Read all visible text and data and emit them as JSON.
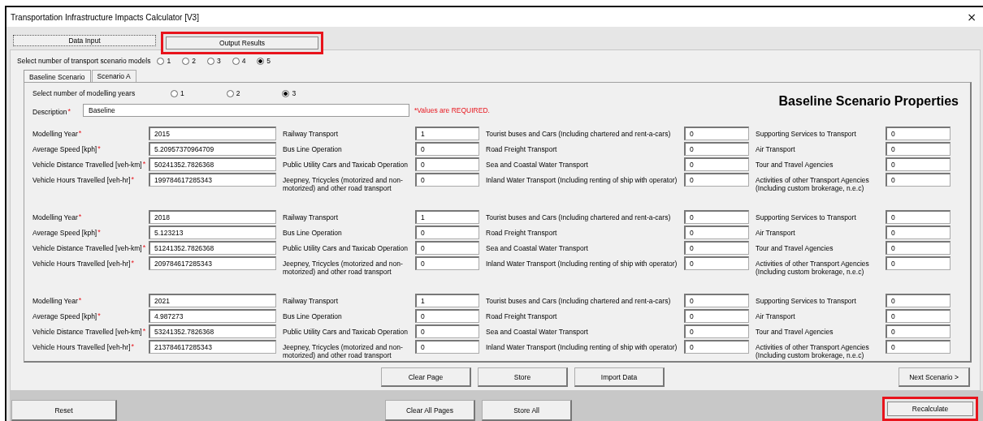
{
  "window": {
    "title": "Transportation Infrastructure Impacts Calculator [V3]",
    "close": "×"
  },
  "main_tabs": [
    {
      "label": "Data Input",
      "selected": true,
      "highlighted": false
    },
    {
      "label": "Output Results",
      "selected": false,
      "highlighted": true
    }
  ],
  "scenario_models": {
    "label": "Select number of transport scenario models",
    "options": [
      {
        "label": "1",
        "selected": false
      },
      {
        "label": "2",
        "selected": false
      },
      {
        "label": "3",
        "selected": false
      },
      {
        "label": "4",
        "selected": false
      },
      {
        "label": "5",
        "selected": true
      }
    ]
  },
  "scenario_tabs": [
    {
      "label": "Baseline Scenario",
      "selected": true
    },
    {
      "label": "Scenario A",
      "selected": false
    }
  ],
  "modeling_years": {
    "label": "Select number of modelling years",
    "options": [
      {
        "label": "1",
        "selected": false
      },
      {
        "label": "2",
        "selected": false
      },
      {
        "label": "3",
        "selected": true
      }
    ]
  },
  "description": {
    "label": "Description",
    "required_mark": "*",
    "value": "Baseline"
  },
  "required_note": "*Values are REQUIRED.",
  "heading": "Baseline Scenario Properties",
  "years": [
    {
      "fields": [
        {
          "label": "Modelling Year",
          "required_mark": "*",
          "value": "2015"
        },
        {
          "label": "Average Speed [kph]",
          "required_mark": "*",
          "value": "5.20957370964709"
        },
        {
          "label": "Vehicle Distance Travelled [veh-km]",
          "required_mark": "*",
          "value": "50241352.7826368"
        },
        {
          "label": "Vehicle Hours Travelled [veh-hr]",
          "required_mark": "*",
          "value": "199784617285343"
        }
      ],
      "sectors": [
        {
          "label": "Railway Transport",
          "value": "1"
        },
        {
          "label": "Bus Line Operation",
          "value": "0"
        },
        {
          "label": "Public Utility Cars and Taxicab Operation",
          "value": "0"
        },
        {
          "label": "Jeepney, Tricycles (motorized and non-motorized) and other road transport",
          "value": "0"
        },
        {
          "label": "Tourist buses and Cars (Including chartered and rent-a-cars)",
          "value": "0"
        },
        {
          "label": "Road Freight Transport",
          "value": "0"
        },
        {
          "label": "Sea and Coastal Water Transport",
          "value": "0"
        },
        {
          "label": "Inland Water Transport (Including renting of ship with operator)",
          "value": "0"
        },
        {
          "label": "Supporting Services to Transport",
          "value": "0"
        },
        {
          "label": "Air Transport",
          "value": "0"
        },
        {
          "label": "Tour and Travel Agencies",
          "value": "0"
        },
        {
          "label": "Activities of other Transport Agencies (Including custom brokerage, n.e.c)",
          "value": "0"
        }
      ]
    },
    {
      "fields": [
        {
          "label": "Modelling Year",
          "required_mark": "*",
          "value": "2018"
        },
        {
          "label": "Average Speed [kph]",
          "required_mark": "*",
          "value": "5.123213"
        },
        {
          "label": "Vehicle Distance Travelled [veh-km]",
          "required_mark": "*",
          "value": "51241352.7826368"
        },
        {
          "label": "Vehicle Hours Travelled [veh-hr]",
          "required_mark": "*",
          "value": "209784617285343"
        }
      ],
      "sectors": [
        {
          "label": "Railway Transport",
          "value": "1"
        },
        {
          "label": "Bus Line Operation",
          "value": "0"
        },
        {
          "label": "Public Utility Cars and Taxicab Operation",
          "value": "0"
        },
        {
          "label": "Jeepney, Tricycles (motorized and non-motorized) and other road transport",
          "value": "0"
        },
        {
          "label": "Tourist buses and Cars (Including chartered and rent-a-cars)",
          "value": "0"
        },
        {
          "label": "Road Freight Transport",
          "value": "0"
        },
        {
          "label": "Sea and Coastal Water Transport",
          "value": "0"
        },
        {
          "label": "Inland Water Transport (Including renting of ship with operator)",
          "value": "0"
        },
        {
          "label": "Supporting Services to Transport",
          "value": "0"
        },
        {
          "label": "Air Transport",
          "value": "0"
        },
        {
          "label": "Tour and Travel Agencies",
          "value": "0"
        },
        {
          "label": "Activities of other Transport Agencies (Including custom brokerage, n.e.c)",
          "value": "0"
        }
      ]
    },
    {
      "fields": [
        {
          "label": "Modelling Year",
          "required_mark": "*",
          "value": "2021"
        },
        {
          "label": "Average Speed [kph]",
          "required_mark": "*",
          "value": "4.987273"
        },
        {
          "label": "Vehicle Distance Travelled [veh-km]",
          "required_mark": "*",
          "value": "53241352.7826368"
        },
        {
          "label": "Vehicle Hours Travelled [veh-hr]",
          "required_mark": "*",
          "value": "213784617285343"
        }
      ],
      "sectors": [
        {
          "label": "Railway Transport",
          "value": "1"
        },
        {
          "label": "Bus Line Operation",
          "value": "0"
        },
        {
          "label": "Public Utility Cars and Taxicab Operation",
          "value": "0"
        },
        {
          "label": "Jeepney, Tricycles (motorized and non-motorized) and other road transport",
          "value": "0"
        },
        {
          "label": "Tourist buses and Cars (Including chartered and rent-a-cars)",
          "value": "0"
        },
        {
          "label": "Road Freight Transport",
          "value": "0"
        },
        {
          "label": "Sea and Coastal Water Transport",
          "value": "0"
        },
        {
          "label": "Inland Water Transport (Including renting of ship with operator)",
          "value": "0"
        },
        {
          "label": "Supporting Services to Transport",
          "value": "0"
        },
        {
          "label": "Air Transport",
          "value": "0"
        },
        {
          "label": "Tour and Travel Agencies",
          "value": "0"
        },
        {
          "label": "Activities of other Transport Agencies (Including custom brokerage, n.e.c)",
          "value": "0"
        }
      ]
    }
  ],
  "page_buttons": [
    {
      "label": "Clear Page",
      "kind": "center"
    },
    {
      "label": "Store",
      "kind": "center"
    },
    {
      "label": "Import Data",
      "kind": "center"
    },
    {
      "label": "Next Scenario >",
      "kind": "right"
    }
  ],
  "footer_buttons": [
    {
      "label": "Reset",
      "kind": "left",
      "highlighted": false
    },
    {
      "label": "Clear All Pages",
      "kind": "center",
      "highlighted": false
    },
    {
      "label": "Store All",
      "kind": "center",
      "highlighted": false
    },
    {
      "label": "Recalculate",
      "kind": "right",
      "highlighted": true
    }
  ]
}
